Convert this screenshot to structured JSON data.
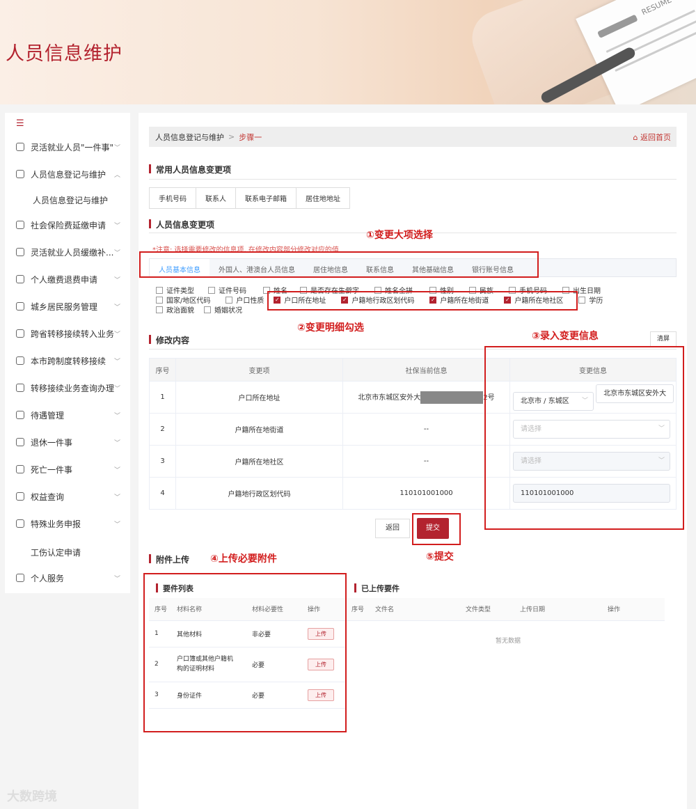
{
  "banner": {
    "title": "人员信息维护",
    "resume_label": "RESUME"
  },
  "sidebar": {
    "toggle": "☰",
    "items": [
      {
        "label": "灵活就业人员\"一件事\"",
        "chevron": "﹀"
      },
      {
        "label": "人员信息登记与维护",
        "chevron": "︿"
      },
      {
        "label": "社会保险费延缴申请",
        "chevron": "﹀"
      },
      {
        "label": "灵活就业人员缓缴补...",
        "chevron": "﹀"
      },
      {
        "label": "个人缴费退费申请",
        "chevron": "﹀"
      },
      {
        "label": "城乡居民服务管理",
        "chevron": "﹀"
      },
      {
        "label": "跨省转移接续转入业务",
        "chevron": "﹀"
      },
      {
        "label": "本市跨制度转移接续",
        "chevron": "﹀"
      },
      {
        "label": "转移接续业务查询办理",
        "chevron": "﹀"
      },
      {
        "label": "待遇管理",
        "chevron": "﹀"
      },
      {
        "label": "退休一件事",
        "chevron": "﹀"
      },
      {
        "label": "死亡一件事",
        "chevron": "﹀"
      },
      {
        "label": "权益查询",
        "chevron": "﹀"
      },
      {
        "label": "特殊业务申报",
        "chevron": "﹀"
      },
      {
        "label": "个人服务",
        "chevron": "﹀"
      }
    ],
    "sub_items": [
      "人员信息登记与维护",
      "工伤认定申请"
    ]
  },
  "breadcrumb": {
    "parent": "人员信息登记与维护",
    "sep": ">",
    "current": "步骤一",
    "home": "返回首页"
  },
  "common": {
    "title": "常用人员信息变更项",
    "quick": [
      "手机号码",
      "联系人",
      "联系电子邮箱",
      "居住地地址"
    ]
  },
  "change": {
    "title": "人员信息变更项",
    "note": "*注意: 选择需要修改的信息项, 在修改内容部分修改对应的值",
    "tabs": [
      "人员基本信息",
      "外国人、港澳台人员信息",
      "居住地信息",
      "联系信息",
      "其他基础信息",
      "银行账号信息"
    ],
    "row1": [
      "证件类型",
      "证件号码",
      "姓名",
      "是否存在生僻字",
      "姓名全拼",
      "性别",
      "民族",
      "手机号码",
      "出生日期"
    ],
    "row2": [
      {
        "label": "国家/地区代码",
        "on": false
      },
      {
        "label": "户口性质",
        "on": false
      },
      {
        "label": "户口所在地址",
        "on": true
      },
      {
        "label": "户籍地行政区划代码",
        "on": true
      },
      {
        "label": "户籍所在地街道",
        "on": true
      },
      {
        "label": "户籍所在地社区",
        "on": true
      },
      {
        "label": "学历",
        "on": false
      }
    ],
    "row3": [
      "政治面貌",
      "婚姻状况"
    ],
    "check_mark": "✓"
  },
  "modify": {
    "title": "修改内容",
    "clear": "清屏",
    "headers": [
      "序号",
      "变更项",
      "社保当前信息",
      "变更信息"
    ],
    "rows": [
      {
        "no": "1",
        "item": "户口所在地址",
        "current_pre": "北京市东城区安外大",
        "current_post": "2号",
        "sel": "北京市 / 东城区",
        "detail": "北京市东城区安外大"
      },
      {
        "no": "2",
        "item": "户籍所在地街道",
        "current": "--",
        "placeholder": "请选择"
      },
      {
        "no": "3",
        "item": "户籍所在地社区",
        "current": "--",
        "placeholder": "请选择"
      },
      {
        "no": "4",
        "item": "户籍地行政区划代码",
        "current": "110101001000",
        "value": "110101001000"
      }
    ]
  },
  "actions": {
    "back": "返回",
    "submit": "提交"
  },
  "attach": {
    "title": "附件上传",
    "list_title": "要件列表",
    "list_headers": [
      "序号",
      "材料名称",
      "材料必要性",
      "操作"
    ],
    "list_rows": [
      {
        "no": "1",
        "name": "其他材料",
        "need": "非必要",
        "op": "上传"
      },
      {
        "no": "2",
        "name": "户口簿或其他户籍机构的证明材料",
        "name_l1": "户口簿或其他户籍机",
        "name_l2": "构的证明材料",
        "need": "必要",
        "op": "上传"
      },
      {
        "no": "3",
        "name": "身份证件",
        "need": "必要",
        "op": "上传"
      }
    ],
    "uploaded_title": "已上传要件",
    "uploaded_headers": [
      "序号",
      "文件名",
      "文件类型",
      "上传日期",
      "操作"
    ],
    "empty": "暂无数据"
  },
  "annotations": {
    "a1": "①变更大项选择",
    "a2": "②变更明细勾选",
    "a3": "③录入变更信息",
    "a4": "④上传必要附件",
    "a5": "⑤提交",
    "color": "#d21d1d"
  },
  "watermark": "大数跨境",
  "colors": {
    "brand": "#b3232f",
    "tab_active": "#409eff"
  }
}
